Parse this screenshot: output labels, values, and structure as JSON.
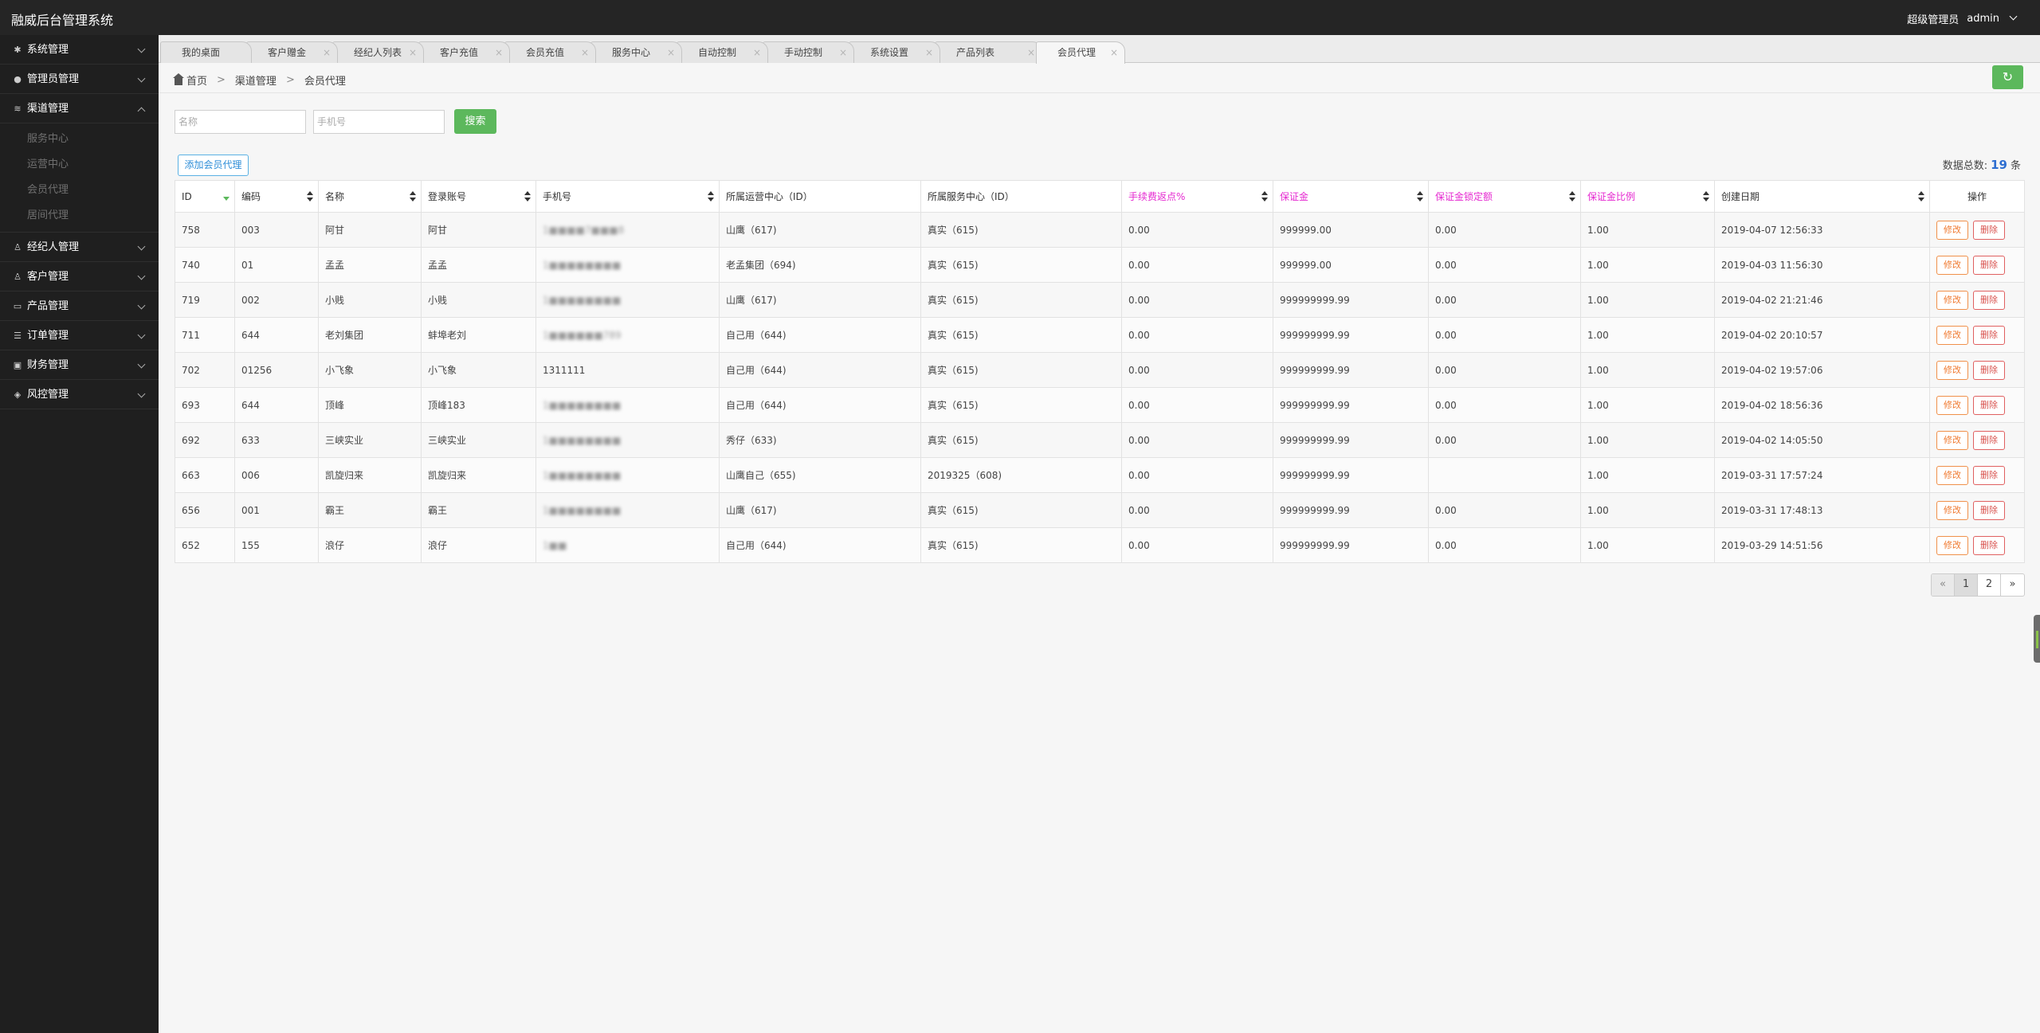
{
  "app": {
    "title": "融威后台管理系统",
    "role": "超级管理员",
    "user": "admin"
  },
  "sidebar": {
    "groups": [
      {
        "label": "系统管理",
        "icon": "gear-icon",
        "glyph": "✱"
      },
      {
        "label": "管理员管理",
        "icon": "user-icon",
        "glyph": "●"
      },
      {
        "label": "渠道管理",
        "icon": "channel-icon",
        "glyph": "≋"
      },
      {
        "label": "经纪人管理",
        "icon": "person-icon",
        "glyph": "♙"
      },
      {
        "label": "客户管理",
        "icon": "person-icon",
        "glyph": "♙"
      },
      {
        "label": "产品管理",
        "icon": "briefcase-icon",
        "glyph": "▭"
      },
      {
        "label": "订单管理",
        "icon": "list-icon",
        "glyph": "☰"
      },
      {
        "label": "财务管理",
        "icon": "lock-icon",
        "glyph": "▣"
      },
      {
        "label": "风控管理",
        "icon": "shield-icon",
        "glyph": "◈"
      }
    ],
    "channel_subitems": [
      "服务中心",
      "运营中心",
      "会员代理",
      "居间代理"
    ]
  },
  "tabs": [
    {
      "label": "我的桌面",
      "closable": false
    },
    {
      "label": "客户赠金",
      "closable": true
    },
    {
      "label": "经纪人列表",
      "closable": true
    },
    {
      "label": "客户充值",
      "closable": true
    },
    {
      "label": "会员充值",
      "closable": true
    },
    {
      "label": "服务中心",
      "closable": true
    },
    {
      "label": "自动控制",
      "closable": true
    },
    {
      "label": "手动控制",
      "closable": true
    },
    {
      "label": "系统设置",
      "closable": true
    },
    {
      "label": "产品列表",
      "closable": true
    },
    {
      "label": "会员代理",
      "closable": true
    }
  ],
  "breadcrumb": {
    "home": "首页",
    "parent": "渠道管理",
    "current": "会员代理",
    "sep": ">"
  },
  "filters": {
    "name_placeholder": "名称",
    "phone_placeholder": "手机号",
    "search_label": "搜索"
  },
  "toolbar": {
    "add_label": "添加会员代理",
    "total_prefix": "数据总数:",
    "total_count": "19",
    "total_suffix": "条"
  },
  "table": {
    "headers": [
      "ID",
      "编码",
      "名称",
      "登录账号",
      "手机号",
      "所属运营中心（ID）",
      "所属服务中心（ID）",
      "手续费返点%",
      "保证金",
      "保证金锁定额",
      "保证金比例",
      "创建日期",
      "操作"
    ],
    "edit_label": "修改",
    "delete_label": "删除",
    "rows": [
      [
        "758",
        "003",
        "阿甘",
        "阿甘",
        "1■■■■7■■■8",
        "山鹰（617)",
        "真实（615)",
        "0.00",
        "999999.00",
        "0.00",
        "1.00",
        "2019-04-07 12:56:33"
      ],
      [
        "740",
        "01",
        "孟孟",
        "孟孟",
        "1■■■■■■■■",
        "老孟集团（694)",
        "真实（615)",
        "0.00",
        "999999.00",
        "0.00",
        "1.00",
        "2019-04-03 11:56:30"
      ],
      [
        "719",
        "002",
        "小贱",
        "小贱",
        "1■■■■■■■■",
        "山鹰（617)",
        "真实（615)",
        "0.00",
        "999999999.99",
        "0.00",
        "1.00",
        "2019-04-02 21:21:46"
      ],
      [
        "711",
        "644",
        "老刘集团",
        "蚌埠老刘",
        "1■■■■■■789",
        "自己用（644)",
        "真实（615)",
        "0.00",
        "999999999.99",
        "0.00",
        "1.00",
        "2019-04-02 20:10:57"
      ],
      [
        "702",
        "01256",
        "小飞象",
        "小飞象",
        "1311111",
        "自己用（644)",
        "真实（615)",
        "0.00",
        "999999999.99",
        "0.00",
        "1.00",
        "2019-04-02 19:57:06"
      ],
      [
        "693",
        "644",
        "顶峰",
        "顶峰183",
        "1■■■■■■■■",
        "自己用（644)",
        "真实（615)",
        "0.00",
        "999999999.99",
        "0.00",
        "1.00",
        "2019-04-02 18:56:36"
      ],
      [
        "692",
        "633",
        "三峡实业",
        "三峡实业",
        "1■■■■■■■■",
        "秀仔（633)",
        "真实（615)",
        "0.00",
        "999999999.99",
        "0.00",
        "1.00",
        "2019-04-02 14:05:50"
      ],
      [
        "663",
        "006",
        "凯旋归来",
        "凯旋归来",
        "1■■■■■■■■",
        "山鹰自己（655)",
        "2019325（608)",
        "0.00",
        "999999999.99",
        "",
        "1.00",
        "2019-03-31 17:57:24"
      ],
      [
        "656",
        "001",
        "霸王",
        "霸王",
        "1■■■■■■■■",
        "山鹰（617)",
        "真实（615)",
        "0.00",
        "999999999.99",
        "0.00",
        "1.00",
        "2019-03-31 17:48:13"
      ],
      [
        "652",
        "155",
        "浪仔",
        "浪仔",
        "1■■",
        "自己用（644)",
        "真实（615)",
        "0.00",
        "999999999.99",
        "0.00",
        "1.00",
        "2019-03-29 14:51:56"
      ]
    ]
  },
  "pagination": {
    "prev": "«",
    "pages": [
      "1",
      "2"
    ],
    "next": "»",
    "current": "1"
  }
}
